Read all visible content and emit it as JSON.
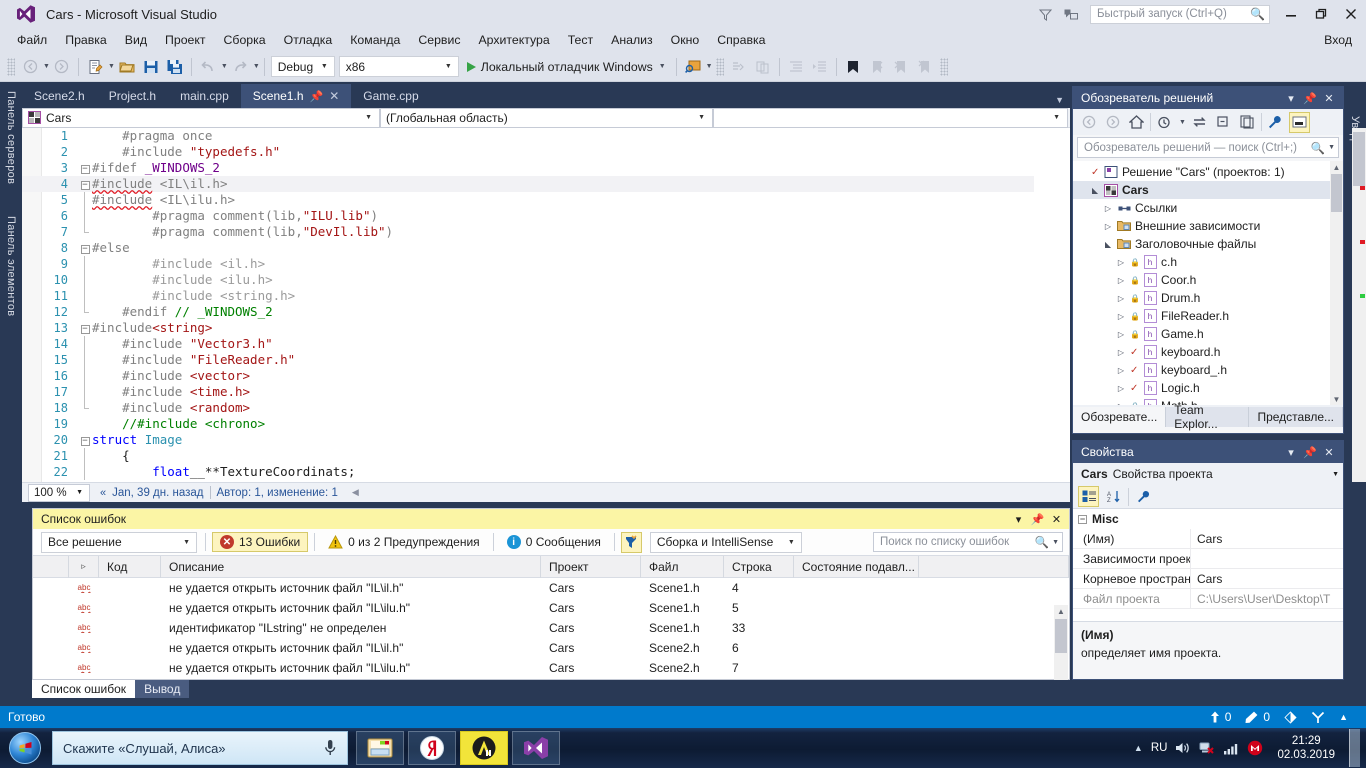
{
  "window": {
    "title": "Cars - Microsoft Visual Studio",
    "quick_launch_placeholder": "Быстрый запуск (Ctrl+Q)",
    "minimize": "—",
    "restore": "❐",
    "close": "✕",
    "feedback_icon": "feedback-icon",
    "filter_icon": "filter-icon"
  },
  "menu": {
    "items": [
      "Файл",
      "Правка",
      "Вид",
      "Проект",
      "Сборка",
      "Отладка",
      "Команда",
      "Сервис",
      "Архитектура",
      "Тест",
      "Анализ",
      "Окно",
      "Справка"
    ],
    "signin": "Вход"
  },
  "toolbar": {
    "config": "Debug",
    "platform": "x86",
    "run_label": "Локальный отладчик Windows"
  },
  "left_tabs": {
    "server_explorer": "Панель серверов",
    "toolbox": "Панель элементов"
  },
  "right_tab": {
    "notifications": "Уведомления"
  },
  "doc_tabs": [
    {
      "label": "Scene2.h",
      "active": false
    },
    {
      "label": "Project.h",
      "active": false
    },
    {
      "label": "main.cpp",
      "active": false
    },
    {
      "label": "Scene1.h",
      "active": true
    },
    {
      "label": "Game.cpp",
      "active": false
    }
  ],
  "navbar": {
    "project": "Cars",
    "scope": "(Глобальная область)",
    "member": ""
  },
  "editor": {
    "zoom": "100 %",
    "codelens_history": "Jan, 39 дн. назад",
    "codelens_authors": "Автор: 1, изменение: 1",
    "lines": [
      {
        "n": "1",
        "fold": "",
        "indent": 1,
        "parts": [
          {
            "t": "#pragma once",
            "c": "pre"
          }
        ]
      },
      {
        "n": "2",
        "fold": "",
        "indent": 1,
        "parts": [
          {
            "t": "#include ",
            "c": "pre"
          },
          {
            "t": "\"typedefs.h\"",
            "c": "str"
          }
        ]
      },
      {
        "n": "3",
        "fold": "minus",
        "indent": 0,
        "parts": [
          {
            "t": "#ifdef ",
            "c": "pre"
          },
          {
            "t": "_WINDOWS_2",
            "c": "macro"
          }
        ]
      },
      {
        "n": "4",
        "fold": "minus",
        "indent": 0,
        "parts": [
          {
            "t": "#include",
            "c": "pre squiggle"
          },
          {
            "t": " <IL\\il.h>",
            "c": "pre"
          }
        ],
        "highlight": true
      },
      {
        "n": "5",
        "fold": "bar",
        "indent": 0,
        "parts": [
          {
            "t": "#include",
            "c": "pre squiggle"
          },
          {
            "t": " <IL\\ilu.h>",
            "c": "pre"
          }
        ]
      },
      {
        "n": "6",
        "fold": "bar",
        "indent": 2,
        "parts": [
          {
            "t": "#pragma comment(lib,",
            "c": "pre"
          },
          {
            "t": "\"ILU.lib\"",
            "c": "str"
          },
          {
            "t": ")",
            "c": "pre"
          }
        ]
      },
      {
        "n": "7",
        "fold": "barend",
        "indent": 2,
        "parts": [
          {
            "t": "#pragma comment(lib,",
            "c": "pre"
          },
          {
            "t": "\"DevIl.lib\"",
            "c": "str"
          },
          {
            "t": ")",
            "c": "pre"
          }
        ]
      },
      {
        "n": "8",
        "fold": "minus",
        "indent": 0,
        "parts": [
          {
            "t": "#else",
            "c": "pre"
          }
        ]
      },
      {
        "n": "9",
        "fold": "bar",
        "indent": 2,
        "parts": [
          {
            "t": "#include <il.h>",
            "c": "dim"
          }
        ]
      },
      {
        "n": "10",
        "fold": "bar",
        "indent": 2,
        "parts": [
          {
            "t": "#include <ilu.h>",
            "c": "dim"
          }
        ]
      },
      {
        "n": "11",
        "fold": "bar",
        "indent": 2,
        "parts": [
          {
            "t": "#include <string.h>",
            "c": "dim"
          }
        ]
      },
      {
        "n": "12",
        "fold": "barend",
        "indent": 1,
        "parts": [
          {
            "t": "#endif ",
            "c": "pre"
          },
          {
            "t": "// _WINDOWS_2",
            "c": "cmt"
          }
        ]
      },
      {
        "n": "13",
        "fold": "minus",
        "indent": 0,
        "parts": [
          {
            "t": "#include",
            "c": "pre"
          },
          {
            "t": "<string>",
            "c": "str"
          }
        ]
      },
      {
        "n": "14",
        "fold": "bar",
        "indent": 1,
        "parts": [
          {
            "t": "#include ",
            "c": "pre"
          },
          {
            "t": "\"Vector3.h\"",
            "c": "str"
          }
        ]
      },
      {
        "n": "15",
        "fold": "bar",
        "indent": 1,
        "parts": [
          {
            "t": "#include ",
            "c": "pre"
          },
          {
            "t": "\"FileReader.h\"",
            "c": "str"
          }
        ]
      },
      {
        "n": "16",
        "fold": "bar",
        "indent": 1,
        "parts": [
          {
            "t": "#include ",
            "c": "pre"
          },
          {
            "t": "<vector>",
            "c": "str"
          }
        ]
      },
      {
        "n": "17",
        "fold": "bar",
        "indent": 1,
        "parts": [
          {
            "t": "#include ",
            "c": "pre"
          },
          {
            "t": "<time.h>",
            "c": "str"
          }
        ]
      },
      {
        "n": "18",
        "fold": "barend",
        "indent": 1,
        "parts": [
          {
            "t": "#include ",
            "c": "pre"
          },
          {
            "t": "<random>",
            "c": "str"
          }
        ]
      },
      {
        "n": "19",
        "fold": "",
        "indent": 1,
        "parts": [
          {
            "t": "//#include <chrono>",
            "c": "cmt"
          }
        ]
      },
      {
        "n": "20",
        "fold": "minus",
        "indent": 0,
        "parts": [
          {
            "t": "struct ",
            "c": "kw"
          },
          {
            "t": "Image",
            "c": "typ"
          }
        ]
      },
      {
        "n": "21",
        "fold": "bar",
        "indent": 1,
        "parts": [
          {
            "t": "{",
            "c": "plain"
          }
        ]
      },
      {
        "n": "22",
        "fold": "bar",
        "indent": 2,
        "parts": [
          {
            "t": "float",
            "c": "kw"
          },
          {
            "t": "__**TextureCoordinats;",
            "c": "plain"
          }
        ]
      }
    ]
  },
  "solution_explorer": {
    "title": "Обозреватель решений",
    "search_placeholder": "Обозреватель решений — поиск (Ctrl+;)",
    "toolbar_icons": [
      "back-icon",
      "forward-icon",
      "home-icon",
      "pending-changes-icon",
      "sync-icon",
      "collapse-all-icon",
      "show-all-files-icon",
      "properties-icon",
      "preview-selected-icon"
    ],
    "tree": [
      {
        "label": "Решение \"Cars\"  (проектов: 1)",
        "depth": 0,
        "arrow": "",
        "icon": "solution-icon",
        "mark": "check-red"
      },
      {
        "label": "Cars",
        "depth": 1,
        "arrow": "down",
        "icon": "cpp-project-icon",
        "selected": true,
        "bold": true
      },
      {
        "label": "Ссылки",
        "depth": 2,
        "arrow": "right",
        "icon": "references-icon"
      },
      {
        "label": "Внешние зависимости",
        "depth": 2,
        "arrow": "right",
        "icon": "folder-icon"
      },
      {
        "label": "Заголовочные файлы",
        "depth": 2,
        "arrow": "down",
        "icon": "folder-icon"
      },
      {
        "label": "c.h",
        "depth": 3,
        "arrow": "right",
        "icon": "h-file-icon",
        "mark": "lock"
      },
      {
        "label": "Coor.h",
        "depth": 3,
        "arrow": "right",
        "icon": "h-file-icon",
        "mark": "lock"
      },
      {
        "label": "Drum.h",
        "depth": 3,
        "arrow": "right",
        "icon": "h-file-icon",
        "mark": "lock"
      },
      {
        "label": "FileReader.h",
        "depth": 3,
        "arrow": "right",
        "icon": "h-file-icon",
        "mark": "lock"
      },
      {
        "label": "Game.h",
        "depth": 3,
        "arrow": "right",
        "icon": "h-file-icon",
        "mark": "lock"
      },
      {
        "label": "keyboard.h",
        "depth": 3,
        "arrow": "right",
        "icon": "h-file-icon",
        "mark": "check"
      },
      {
        "label": "keyboard_.h",
        "depth": 3,
        "arrow": "right",
        "icon": "h-file-icon",
        "mark": "check"
      },
      {
        "label": "Logic.h",
        "depth": 3,
        "arrow": "right",
        "icon": "h-file-icon",
        "mark": "check"
      },
      {
        "label": "Math.h",
        "depth": 3,
        "arrow": "right",
        "icon": "h-file-icon",
        "mark": "lock"
      }
    ],
    "tabs": [
      {
        "label": "Обозревате...",
        "active": true
      },
      {
        "label": "Team Explor...",
        "active": false
      },
      {
        "label": "Представле...",
        "active": false
      }
    ]
  },
  "properties": {
    "title": "Свойства",
    "object_bold": "Cars",
    "object_rest": "Свойства проекта",
    "group": "Misc",
    "rows": [
      {
        "key": "(Имя)",
        "value": "Cars",
        "grey": false
      },
      {
        "key": "Зависимости проекта",
        "value": "",
        "grey": false
      },
      {
        "key": "Корневое пространство имен",
        "value": "Cars",
        "grey": false
      },
      {
        "key": "Файл проекта",
        "value": "C:\\Users\\User\\Desktop\\T",
        "grey": true
      }
    ],
    "desc_title": "(Имя)",
    "desc_body": "определяет имя проекта."
  },
  "error_list": {
    "title": "Список ошибок",
    "scope": "Все решение",
    "errors_label": "13 Ошибки",
    "warnings_label": "0 из 2 Предупреждения",
    "messages_label": "0 Сообщения",
    "source_filter": "Сборка и IntelliSense",
    "search_placeholder": "Поиск по списку ошибок",
    "columns": [
      "",
      "",
      "Код",
      "Описание",
      "Проект",
      "Файл",
      "Строка",
      "Состояние подавл...",
      ""
    ],
    "rows": [
      {
        "icon": "abc",
        "code": "",
        "description": "не удается открыть источник файл \"IL\\il.h\"",
        "project": "Cars",
        "file": "Scene1.h",
        "line": "4",
        "suppression": ""
      },
      {
        "icon": "abc",
        "code": "",
        "description": "не удается открыть источник файл \"IL\\ilu.h\"",
        "project": "Cars",
        "file": "Scene1.h",
        "line": "5",
        "suppression": ""
      },
      {
        "icon": "abc",
        "code": "",
        "description": "идентификатор \"ILstring\" не определен",
        "project": "Cars",
        "file": "Scene1.h",
        "line": "33",
        "suppression": ""
      },
      {
        "icon": "abc",
        "code": "",
        "description": "не удается открыть источник файл \"IL\\il.h\"",
        "project": "Cars",
        "file": "Scene2.h",
        "line": "6",
        "suppression": ""
      },
      {
        "icon": "abc",
        "code": "",
        "description": "не удается открыть источник файл \"IL\\ilu.h\"",
        "project": "Cars",
        "file": "Scene2.h",
        "line": "7",
        "suppression": ""
      }
    ],
    "tabs": [
      {
        "label": "Список ошибок",
        "active": true
      },
      {
        "label": "Вывод",
        "active": false
      }
    ]
  },
  "statusbar": {
    "text": "Готово",
    "up_count": "0",
    "edit_count": "0",
    "source_control_icon": "source-control-icon",
    "branch_icon": "branch-icon",
    "expand_icon": "chevron-up-icon"
  },
  "taskbar": {
    "alisa_text": "Скажите «Слушай, Алиса»",
    "apps": [
      {
        "name": "explorer-taskbar-icon",
        "active": false
      },
      {
        "name": "yandex-browser-taskbar-icon",
        "active": false
      },
      {
        "name": "autocad-taskbar-icon",
        "active": true
      },
      {
        "name": "visual-studio-taskbar-icon",
        "active": false
      }
    ],
    "tray_lang": "RU",
    "clock_time": "21:29",
    "clock_date": "02.03.2019"
  },
  "colors": {
    "titlebar": "#dfe3ec",
    "chrome_dark": "#293955",
    "accent_blue": "#007acc",
    "tab_active": "#3d5178",
    "error_red": "#c0392b",
    "warning_yellow": "#f1c40f",
    "info_blue": "#1b94d6"
  }
}
